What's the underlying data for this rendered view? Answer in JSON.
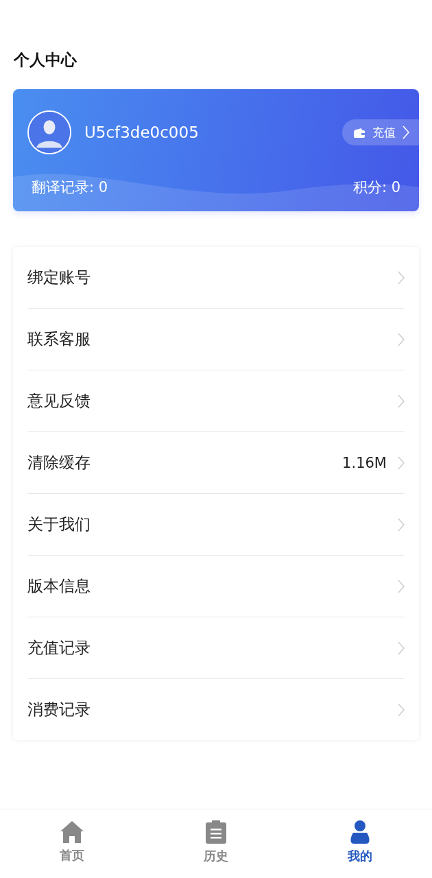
{
  "page_title": "个人中心",
  "profile": {
    "username": "U5cf3de0c005",
    "recharge_button": "充值",
    "translation_records": "翻译记录: 0",
    "points": "积分: 0"
  },
  "menu": [
    {
      "label": "绑定账号"
    },
    {
      "label": "联系客服"
    },
    {
      "label": "意见反馈"
    },
    {
      "label": "清除缓存",
      "value": "1.16M"
    },
    {
      "label": "关于我们"
    },
    {
      "label": "版本信息"
    },
    {
      "label": "充值记录"
    },
    {
      "label": "消费记录"
    }
  ],
  "tabbar": [
    {
      "label": "首页",
      "kind": "home",
      "selected": false
    },
    {
      "label": "历史",
      "kind": "history",
      "selected": false
    },
    {
      "label": "我的",
      "kind": "profile",
      "selected": true
    }
  ]
}
